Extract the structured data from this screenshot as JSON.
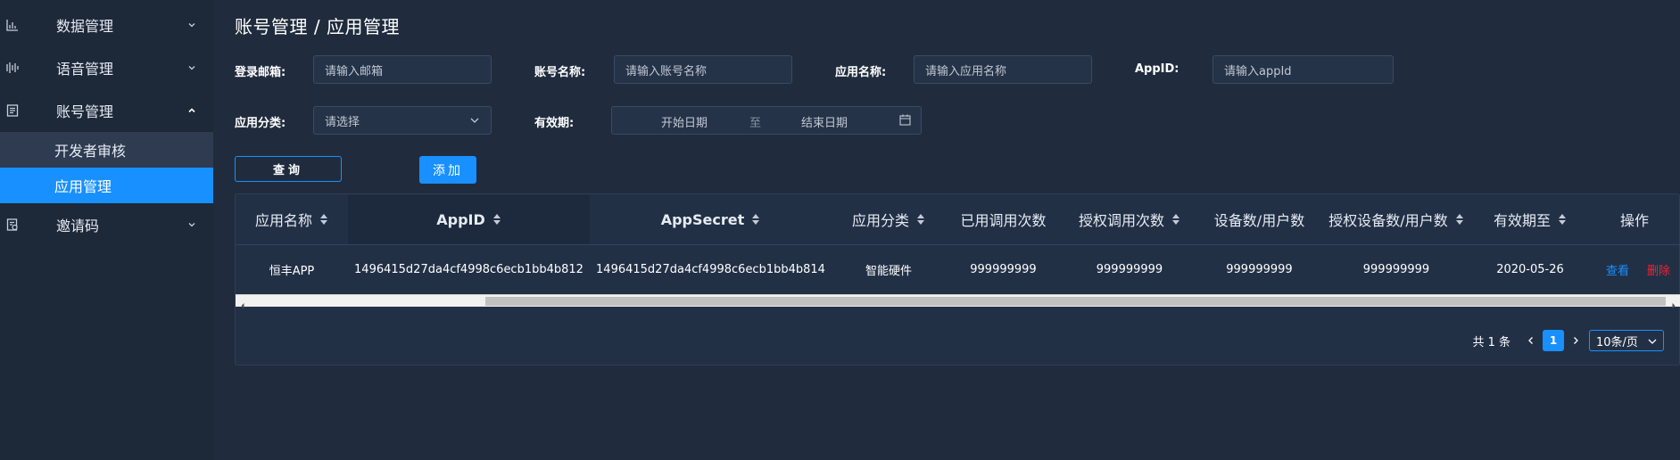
{
  "sidebar": {
    "menu": [
      {
        "label": "数据管理",
        "icon": "bar-chart-icon"
      },
      {
        "label": "语音管理",
        "icon": "audio-wave-icon"
      },
      {
        "label": "账号管理",
        "icon": "account-doc-icon"
      },
      {
        "label": "邀请码",
        "icon": "invite-code-icon"
      }
    ],
    "sub_items": [
      {
        "label": "开发者审核"
      },
      {
        "label": "应用管理"
      }
    ]
  },
  "page_title": "账号管理 / 应用管理",
  "filters": {
    "email": {
      "label": "登录邮箱:",
      "placeholder": "请输入邮箱"
    },
    "account_name": {
      "label": "账号名称:",
      "placeholder": "请输入账号名称"
    },
    "app_name": {
      "label": "应用名称:",
      "placeholder": "请输入应用名称"
    },
    "appid": {
      "label": "AppID:",
      "placeholder": "请输入appId"
    },
    "category": {
      "label": "应用分类:",
      "placeholder": "请选择"
    },
    "validity": {
      "label": "有效期:",
      "start_placeholder": "开始日期",
      "separator": "至",
      "end_placeholder": "结束日期"
    }
  },
  "actions": {
    "query": "查询",
    "add": "添加"
  },
  "table": {
    "columns": [
      {
        "label": "应用名称",
        "sortable": true
      },
      {
        "label": "AppID",
        "sortable": true
      },
      {
        "label": "AppSecret",
        "sortable": true
      },
      {
        "label": "应用分类",
        "sortable": true
      },
      {
        "label": "已用调用次数",
        "sortable": false
      },
      {
        "label": "授权调用次数",
        "sortable": true
      },
      {
        "label": "设备数/用户数",
        "sortable": false
      },
      {
        "label": "授权设备数/用户数",
        "sortable": true
      },
      {
        "label": "有效期至",
        "sortable": true
      },
      {
        "label": "操作",
        "sortable": false
      }
    ],
    "rows": [
      {
        "app_name": "恒丰APP",
        "appid": "1496415d27da4cf4998c6ecb1bb4b812",
        "appsecret": "1496415d27da4cf4998c6ecb1bb4b814",
        "category": "智能硬件",
        "used_calls": "999999999",
        "auth_calls": "999999999",
        "devices_users": "999999999",
        "auth_devices_users": "999999999",
        "expiry": "2020-05-26",
        "op_view": "查看",
        "op_delete": "删除"
      }
    ]
  },
  "pagination": {
    "total": "共 1 条",
    "current": "1",
    "page_size": "10条/页"
  },
  "colors": {
    "accent": "#1890ff",
    "danger": "#f5222d",
    "sidebar_bg": "#1d2839",
    "page_bg": "#202c3d"
  }
}
